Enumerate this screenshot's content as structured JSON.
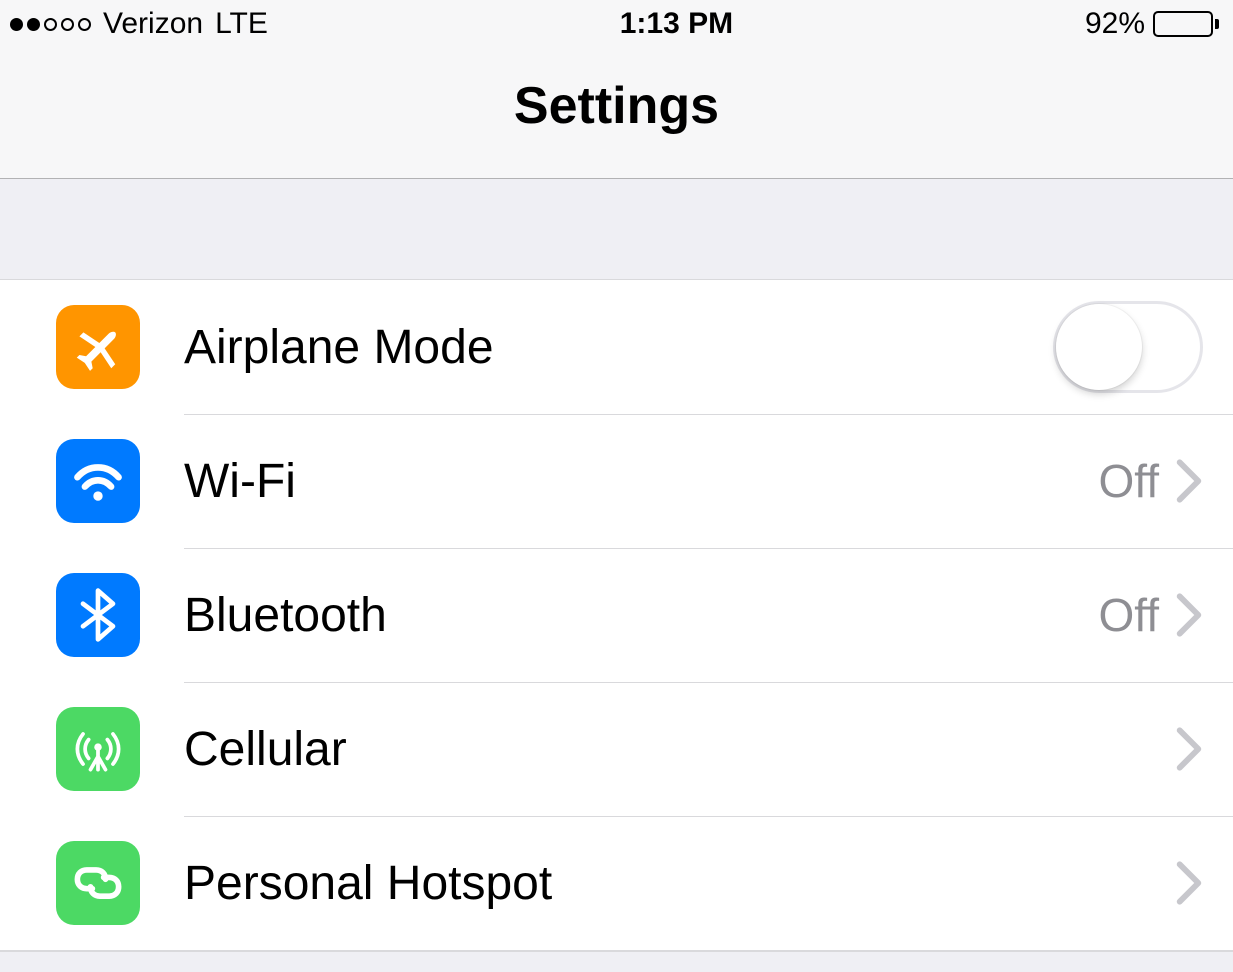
{
  "status_bar": {
    "signal_filled": 2,
    "signal_total": 5,
    "carrier": "Verizon",
    "network": "LTE",
    "time": "1:13 PM",
    "battery_percent": "92%"
  },
  "nav": {
    "title": "Settings"
  },
  "rows": {
    "airplane": {
      "label": "Airplane Mode",
      "toggle_on": false
    },
    "wifi": {
      "label": "Wi-Fi",
      "value": "Off"
    },
    "bluetooth": {
      "label": "Bluetooth",
      "value": "Off"
    },
    "cellular": {
      "label": "Cellular",
      "value": ""
    },
    "hotspot": {
      "label": "Personal Hotspot",
      "value": ""
    }
  },
  "colors": {
    "orange": "#ff9500",
    "blue": "#007aff",
    "green": "#4cd964"
  }
}
